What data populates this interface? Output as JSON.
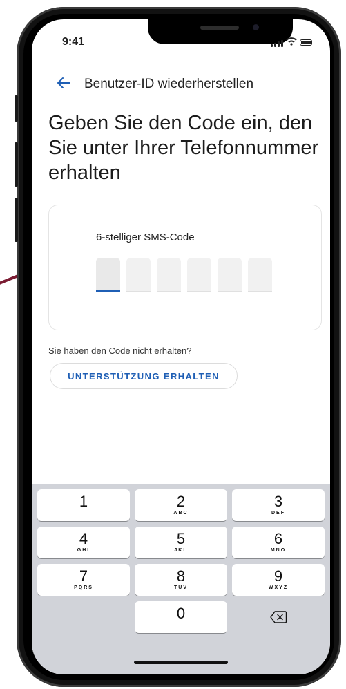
{
  "status_bar": {
    "time": "9:41"
  },
  "nav": {
    "back_icon": "arrow-left-icon",
    "title": "Benutzer-ID wiederherstellen"
  },
  "headline": "Geben Sie den Code ein, den Sie unter Ihrer Telefonnummer erhalten",
  "code_entry": {
    "label": "6-stelliger SMS-Code",
    "digit_count": 6,
    "active_index": 0
  },
  "help": {
    "text": "Sie haben den Code nicht erhalten?",
    "button_label": "UNTERSTÜTZUNG ERHALTEN"
  },
  "keypad": {
    "keys": [
      {
        "digit": "1",
        "letters": ""
      },
      {
        "digit": "2",
        "letters": "ABC"
      },
      {
        "digit": "3",
        "letters": "DEF"
      },
      {
        "digit": "4",
        "letters": "GHI"
      },
      {
        "digit": "5",
        "letters": "JKL"
      },
      {
        "digit": "6",
        "letters": "MNO"
      },
      {
        "digit": "7",
        "letters": "PQRS"
      },
      {
        "digit": "8",
        "letters": "TUV"
      },
      {
        "digit": "9",
        "letters": "WXYZ"
      },
      {
        "digit": "0",
        "letters": ""
      }
    ],
    "delete_icon": "backspace-icon"
  },
  "colors": {
    "accent": "#1f5fb5",
    "frame": "#121212",
    "keypad_bg": "#d1d3d9",
    "brand_line": "#7b1c33"
  }
}
